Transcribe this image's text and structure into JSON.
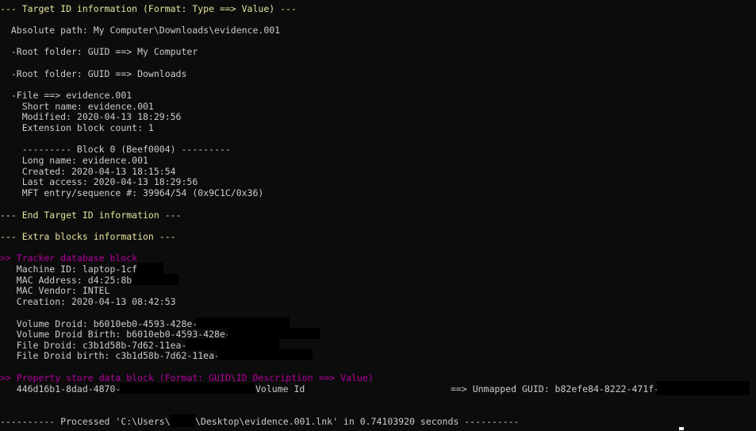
{
  "terminal": {
    "target_header": "--- Target ID information (Format: Type ==> Value) ---",
    "absolute_path": "  Absolute path: My Computer\\Downloads\\evidence.001",
    "root_folder_1": "  -Root folder: GUID ==> My Computer",
    "root_folder_2": "  -Root folder: GUID ==> Downloads",
    "file_line": "  -File ==> evidence.001",
    "short_name": "    Short name: evidence.001",
    "modified": "    Modified: 2020-04-13 18:29:56",
    "ext_block_count": "    Extension block count: 1",
    "block_header": "    --------- Block 0 (Beef0004) ---------",
    "long_name": "    Long name: evidence.001",
    "created": "    Created: 2020-04-13 18:15:54",
    "last_access": "    Last access: 2020-04-13 18:29:56",
    "mft_entry": "    MFT entry/sequence #: 39964/54 (0x9C1C/0x36)",
    "end_target": "--- End Target ID information ---",
    "extra_header": "--- Extra blocks information ---",
    "tracker_header": ">> Tracker database block",
    "machine_id": "   Machine ID: laptop-1cf",
    "mac_address": "   MAC Address: d4:25:8b",
    "mac_vendor": "   MAC Vendor: INTEL",
    "creation": "   Creation: 2020-04-13 08:42:53",
    "volume_droid": "   Volume Droid: b6010eb0-4593-428e-",
    "volume_droid_birth": "   Volume Droid Birth: b6010eb0-4593-428e-",
    "file_droid": "   File Droid: c3b1d58b-7d62-11ea-",
    "file_droid_birth": "   File Droid birth: c3b1d58b-7d62-11ea-",
    "property_header": ">> Property store data block (Format: GUID\\ID Description ==> Value)",
    "property_guid": "   446d16b1-8dad-4870-",
    "property_desc": "Volume Id",
    "property_value": "==> Unmapped GUID: b82efe84-8222-471f-",
    "processed_prefix": "---------- Processed 'C:\\Users\\",
    "processed_suffix": "\\Desktop\\evidence.001.lnk' in 0.74103920 seconds ----------"
  }
}
